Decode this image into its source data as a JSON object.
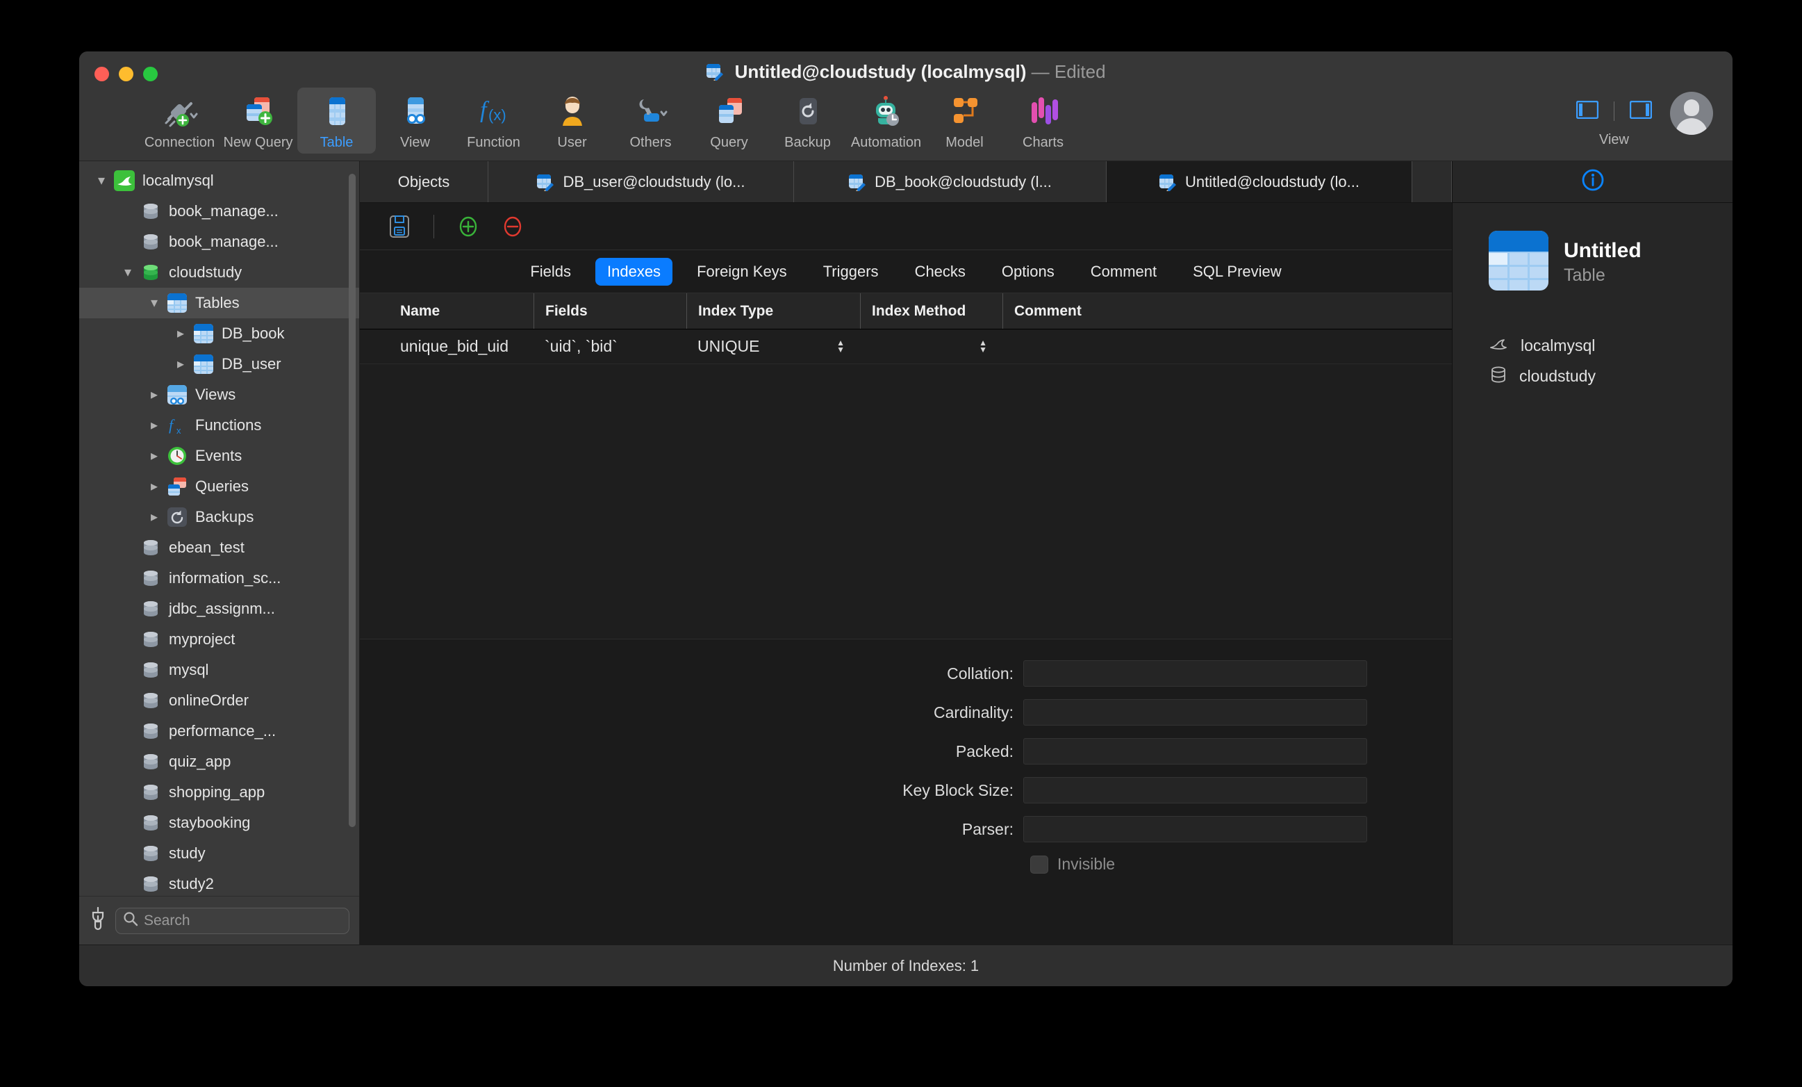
{
  "window": {
    "title": "Untitled@cloudstudy (localmysql)",
    "edited_suffix": "— Edited"
  },
  "toolbar": {
    "items": [
      {
        "label": "Connection",
        "icon": "connection-icon"
      },
      {
        "label": "New Query",
        "icon": "new-query-icon"
      },
      {
        "label": "Table",
        "icon": "table-icon",
        "active": true
      },
      {
        "label": "View",
        "icon": "view-icon"
      },
      {
        "label": "Function",
        "icon": "function-icon"
      },
      {
        "label": "User",
        "icon": "user-icon"
      },
      {
        "label": "Others",
        "icon": "others-icon"
      },
      {
        "label": "Query",
        "icon": "query-icon"
      },
      {
        "label": "Backup",
        "icon": "backup-icon"
      },
      {
        "label": "Automation",
        "icon": "automation-icon"
      },
      {
        "label": "Model",
        "icon": "model-icon"
      },
      {
        "label": "Charts",
        "icon": "charts-icon"
      }
    ],
    "view_label": "View"
  },
  "sidebar": {
    "search_placeholder": "Search",
    "search_value": "",
    "tree": [
      {
        "label": "localmysql",
        "indent": 0,
        "twisty": "down",
        "icon": "mysql-dolphin-icon",
        "selected": false
      },
      {
        "label": "book_manage...",
        "indent": 1,
        "twisty": "none",
        "icon": "database-gray-icon",
        "selected": false
      },
      {
        "label": "book_manage...",
        "indent": 1,
        "twisty": "none",
        "icon": "database-gray-icon",
        "selected": false
      },
      {
        "label": "cloudstudy",
        "indent": 1,
        "twisty": "down",
        "icon": "database-green-icon",
        "selected": false
      },
      {
        "label": "Tables",
        "indent": 2,
        "twisty": "down",
        "icon": "table-icon",
        "selected": true
      },
      {
        "label": "DB_book",
        "indent": 3,
        "twisty": "right",
        "icon": "table-icon",
        "selected": false
      },
      {
        "label": "DB_user",
        "indent": 3,
        "twisty": "right",
        "icon": "table-icon",
        "selected": false
      },
      {
        "label": "Views",
        "indent": 2,
        "twisty": "right",
        "icon": "view-icon",
        "selected": false
      },
      {
        "label": "Functions",
        "indent": 2,
        "twisty": "right",
        "icon": "function-icon",
        "selected": false
      },
      {
        "label": "Events",
        "indent": 2,
        "twisty": "right",
        "icon": "events-clock-icon",
        "selected": false
      },
      {
        "label": "Queries",
        "indent": 2,
        "twisty": "right",
        "icon": "queries-icon",
        "selected": false
      },
      {
        "label": "Backups",
        "indent": 2,
        "twisty": "right",
        "icon": "backup-icon",
        "selected": false
      },
      {
        "label": "ebean_test",
        "indent": 1,
        "twisty": "none",
        "icon": "database-gray-icon",
        "selected": false
      },
      {
        "label": "information_sc...",
        "indent": 1,
        "twisty": "none",
        "icon": "database-gray-icon",
        "selected": false
      },
      {
        "label": "jdbc_assignm...",
        "indent": 1,
        "twisty": "none",
        "icon": "database-gray-icon",
        "selected": false
      },
      {
        "label": "myproject",
        "indent": 1,
        "twisty": "none",
        "icon": "database-gray-icon",
        "selected": false
      },
      {
        "label": "mysql",
        "indent": 1,
        "twisty": "none",
        "icon": "database-gray-icon",
        "selected": false
      },
      {
        "label": "onlineOrder",
        "indent": 1,
        "twisty": "none",
        "icon": "database-gray-icon",
        "selected": false
      },
      {
        "label": "performance_...",
        "indent": 1,
        "twisty": "none",
        "icon": "database-gray-icon",
        "selected": false
      },
      {
        "label": "quiz_app",
        "indent": 1,
        "twisty": "none",
        "icon": "database-gray-icon",
        "selected": false
      },
      {
        "label": "shopping_app",
        "indent": 1,
        "twisty": "none",
        "icon": "database-gray-icon",
        "selected": false
      },
      {
        "label": "staybooking",
        "indent": 1,
        "twisty": "none",
        "icon": "database-gray-icon",
        "selected": false
      },
      {
        "label": "study",
        "indent": 1,
        "twisty": "none",
        "icon": "database-gray-icon",
        "selected": false
      },
      {
        "label": "study2",
        "indent": 1,
        "twisty": "none",
        "icon": "database-gray-icon",
        "selected": false
      }
    ]
  },
  "doc_tabs": [
    {
      "label": "Objects",
      "icon": null,
      "active": false
    },
    {
      "label": "DB_user@cloudstudy (lo...",
      "icon": "table-edit-icon",
      "active": false
    },
    {
      "label": "DB_book@cloudstudy (l...",
      "icon": "table-edit-icon",
      "active": false
    },
    {
      "label": "Untitled@cloudstudy (lo...",
      "icon": "table-edit-icon",
      "active": true
    }
  ],
  "editor": {
    "actions": [
      {
        "name": "save-icon",
        "label": "Save"
      },
      {
        "name": "add-index-icon",
        "label": "Add Index"
      },
      {
        "name": "delete-index-icon",
        "label": "Delete Index"
      }
    ],
    "subtabs": [
      {
        "label": "Fields",
        "active": false
      },
      {
        "label": "Indexes",
        "active": true
      },
      {
        "label": "Foreign Keys",
        "active": false
      },
      {
        "label": "Triggers",
        "active": false
      },
      {
        "label": "Checks",
        "active": false
      },
      {
        "label": "Options",
        "active": false
      },
      {
        "label": "Comment",
        "active": false
      },
      {
        "label": "SQL Preview",
        "active": false
      }
    ],
    "grid": {
      "columns": [
        "Name",
        "Fields",
        "Index Type",
        "Index Method",
        "Comment"
      ],
      "rows": [
        {
          "Name": "unique_bid_uid",
          "Fields": "`uid`, `bid`",
          "Index Type": "UNIQUE",
          "Index Method": "",
          "Comment": ""
        }
      ]
    },
    "detail": {
      "fields": [
        {
          "label": "Collation:",
          "value": ""
        },
        {
          "label": "Cardinality:",
          "value": ""
        },
        {
          "label": "Packed:",
          "value": ""
        },
        {
          "label": "Key Block Size:",
          "value": ""
        },
        {
          "label": "Parser:",
          "value": ""
        }
      ],
      "invisible_label": "Invisible",
      "invisible_checked": false
    }
  },
  "info_panel": {
    "header_icon": "info-circle-icon",
    "name": "Untitled",
    "type": "Table",
    "connection": "localmysql",
    "database": "cloudstudy"
  },
  "status": {
    "text": "Number of Indexes: 1"
  },
  "colors": {
    "accent": "#0a7cff",
    "toolbar_bg": "#373737",
    "sidebar_bg": "#3a3a3a",
    "editor_bg": "#1b1b1b",
    "grid_bg": "#1e1e1e"
  }
}
